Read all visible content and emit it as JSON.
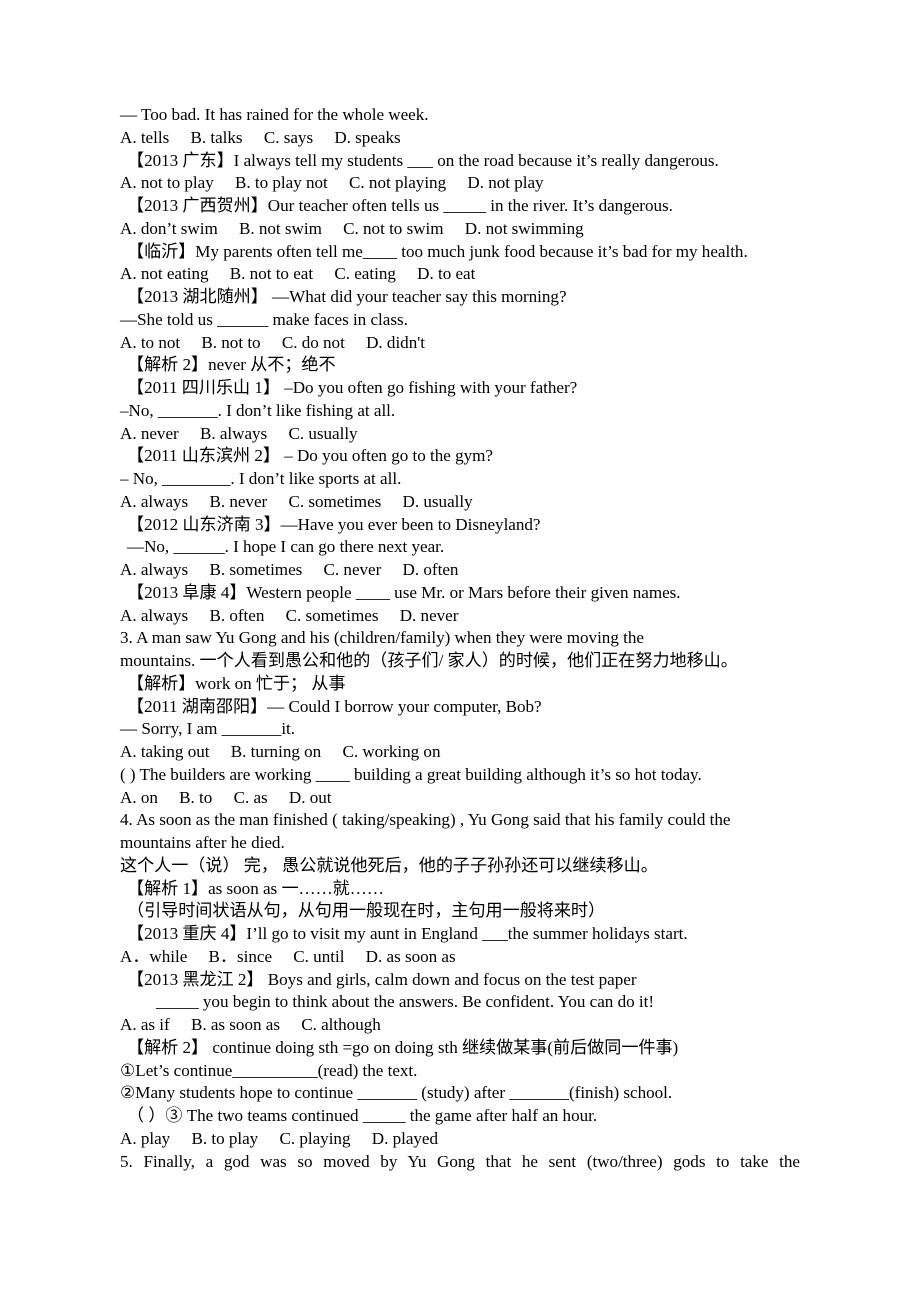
{
  "document": {
    "page_background": "#ffffff",
    "text_color": "#000000",
    "lines": [
      {
        "id": "l01",
        "text": "— Too bad. It has rained for the whole week.",
        "indent": "none",
        "align": "left"
      },
      {
        "id": "l02",
        "text": "A. tells     B. talks     C. says     D. speaks",
        "indent": "none",
        "align": "left"
      },
      {
        "id": "l03",
        "text": "【2013 广东】I always tell my students ___ on the road because it’s really dangerous.",
        "indent": "small",
        "align": "left"
      },
      {
        "id": "l04",
        "text": "A. not to play     B. to play not     C. not playing     D. not play",
        "indent": "none",
        "align": "left"
      },
      {
        "id": "l05",
        "text": "【2013 广西贺州】Our teacher often tells us _____ in the river. It’s dangerous.",
        "indent": "small",
        "align": "left"
      },
      {
        "id": "l06",
        "text": "A. don’t swim     B. not swim     C. not to swim     D. not swimming",
        "indent": "none",
        "align": "left"
      },
      {
        "id": "l07",
        "text": "【临沂】My parents often tell me____ too much junk food because it’s bad for my health.",
        "indent": "small",
        "align": "left"
      },
      {
        "id": "l08",
        "text": "A. not eating     B. not to eat     C. eating     D. to eat",
        "indent": "none",
        "align": "left"
      },
      {
        "id": "l09",
        "text": "【2013 湖北随州】 —What did your teacher say this morning?",
        "indent": "small",
        "align": "left"
      },
      {
        "id": "l10",
        "text": "—She told us ______ make faces in class.",
        "indent": "none",
        "align": "left"
      },
      {
        "id": "l11",
        "text": "A. to not     B. not to     C. do not     D. didn't",
        "indent": "none",
        "align": "left"
      },
      {
        "id": "l12",
        "text": "【解析 2】never 从不；绝不",
        "indent": "small",
        "align": "left"
      },
      {
        "id": "l13",
        "text": "【2011 四川乐山 1】 –Do you often go fishing with your father?",
        "indent": "small",
        "align": "left"
      },
      {
        "id": "l14",
        "text": "–No, _______. I don’t like fishing at all.",
        "indent": "none",
        "align": "left"
      },
      {
        "id": "l15",
        "text": "A. never     B. always     C. usually",
        "indent": "none",
        "align": "left"
      },
      {
        "id": "l16",
        "text": "【2011 山东滨州 2】 – Do you often go to the gym?",
        "indent": "small",
        "align": "left"
      },
      {
        "id": "l17",
        "text": "– No, ________. I don’t like sports at all.",
        "indent": "none",
        "align": "left"
      },
      {
        "id": "l18",
        "text": "A. always     B. never     C. sometimes     D. usually",
        "indent": "none",
        "align": "left"
      },
      {
        "id": "l19",
        "text": "【2012 山东济南 3】—Have you ever been to Disneyland?",
        "indent": "small",
        "align": "left"
      },
      {
        "id": "l20",
        "text": "—No, ______. I hope I can go there next year.",
        "indent": "small",
        "align": "left"
      },
      {
        "id": "l21",
        "text": "A. always     B. sometimes     C. never     D. often",
        "indent": "none",
        "align": "left"
      },
      {
        "id": "l22",
        "text": "【2013 阜康 4】Western people ____ use Mr. or Mars before their given names.",
        "indent": "small",
        "align": "left"
      },
      {
        "id": "l23",
        "text": "A. always     B. often     C. sometimes     D. never",
        "indent": "none",
        "align": "left"
      },
      {
        "id": "l24",
        "text": "3. A man saw Yu Gong and his (children/family) when they were moving the",
        "indent": "none",
        "align": "left"
      },
      {
        "id": "l25",
        "text": "mountains. 一个人看到愚公和他的（孩子们/ 家人）的时候，他们正在努力地移山。",
        "indent": "none",
        "align": "left"
      },
      {
        "id": "l26",
        "text": "【解析】work on 忙于； 从事",
        "indent": "small",
        "align": "left"
      },
      {
        "id": "l27",
        "text": "【2011 湖南邵阳】— Could I borrow your computer, Bob?",
        "indent": "small",
        "align": "left"
      },
      {
        "id": "l28",
        "text": "— Sorry, I am _______it.",
        "indent": "none",
        "align": "left"
      },
      {
        "id": "l29",
        "text": "A. taking out     B. turning on     C. working on",
        "indent": "none",
        "align": "left"
      },
      {
        "id": "l30",
        "text": "( ) The builders are working ____ building a great building although it’s so hot today.",
        "indent": "none",
        "align": "left"
      },
      {
        "id": "l31",
        "text": "A. on     B. to     C. as     D. out",
        "indent": "none",
        "align": "left"
      },
      {
        "id": "l32",
        "text": "4. As soon as the man finished ( taking/speaking) , Yu Gong said that his family could the",
        "indent": "none",
        "align": "left"
      },
      {
        "id": "l33",
        "text": "mountains after he died.",
        "indent": "none",
        "align": "left"
      },
      {
        "id": "l34",
        "text": "这个人一（说） 完， 愚公就说他死后，他的子子孙孙还可以继续移山。",
        "indent": "none",
        "align": "left"
      },
      {
        "id": "l35",
        "text": "【解析 1】as soon as 一……就……",
        "indent": "small",
        "align": "left"
      },
      {
        "id": "l36",
        "text": "（引导时间状语从句，从句用一般现在时，主句用一般将来时）",
        "indent": "small",
        "align": "left"
      },
      {
        "id": "l37",
        "text": "【2013 重庆 4】I’ll go to visit my aunt in England ___the summer holidays start.",
        "indent": "small",
        "align": "left"
      },
      {
        "id": "l38",
        "text": "A．while     B．since     C. until     D. as soon as",
        "indent": "none",
        "align": "left"
      },
      {
        "id": "l39",
        "text": "【2013 黑龙江 2】 Boys and girls, calm down and focus on the test paper",
        "indent": "small",
        "align": "left"
      },
      {
        "id": "l40",
        "text": "_____ you begin to think about the answers. Be confident. You can do it!",
        "indent": "medium",
        "align": "left"
      },
      {
        "id": "l41",
        "text": "A. as if     B. as soon as     C. although",
        "indent": "none",
        "align": "left"
      },
      {
        "id": "l42",
        "text": "【解析 2】 continue doing sth =go on doing sth 继续做某事(前后做同一件事)",
        "indent": "small",
        "align": "left"
      },
      {
        "id": "l43",
        "text": "①Let’s continue__________(read) the text.",
        "indent": "none",
        "align": "left"
      },
      {
        "id": "l44",
        "text": "②Many students hope to continue _______ (study) after _______(finish) school.",
        "indent": "none",
        "align": "left"
      },
      {
        "id": "l45",
        "text": "（ ）③ The two teams continued _____ the game after half an hour.",
        "indent": "small",
        "align": "left"
      },
      {
        "id": "l46",
        "text": "A. play     B. to play     C. playing     D. played",
        "indent": "none",
        "align": "left"
      },
      {
        "id": "l47",
        "text": "5. Finally, a god was so moved by Yu Gong that he sent (two/three) gods to take the",
        "indent": "none",
        "align": "justify-all"
      }
    ]
  }
}
